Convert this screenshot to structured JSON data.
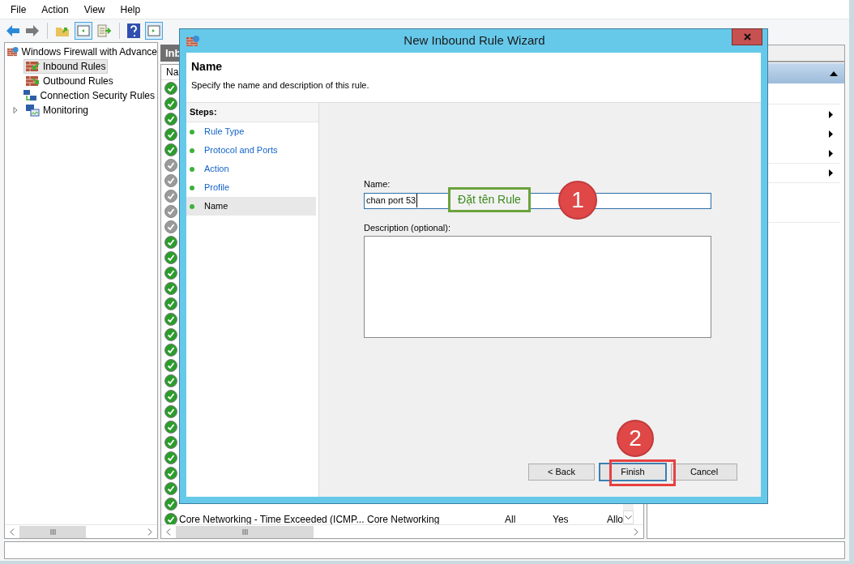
{
  "menu": [
    "File",
    "Action",
    "View",
    "Help"
  ],
  "tree": {
    "label": "Windows Firewall with Advance",
    "children": [
      {
        "label": "Inbound Rules",
        "selected": true,
        "kind": "inbound"
      },
      {
        "label": "Outbound Rules",
        "selected": false,
        "kind": "outbound"
      },
      {
        "label": "Connection Security Rules",
        "selected": false,
        "kind": "security"
      },
      {
        "label": "Monitoring",
        "selected": false,
        "kind": "monitor",
        "expanded": false
      }
    ]
  },
  "rules_pane": {
    "title": "Inb",
    "column_1": "Na",
    "rows": [
      {
        "enabled": true
      },
      {
        "enabled": true
      },
      {
        "enabled": true
      },
      {
        "enabled": true
      },
      {
        "enabled": true
      },
      {
        "enabled": false
      },
      {
        "enabled": false
      },
      {
        "enabled": false
      },
      {
        "enabled": false
      },
      {
        "enabled": false
      },
      {
        "enabled": true
      },
      {
        "enabled": true
      },
      {
        "enabled": true
      },
      {
        "enabled": true
      },
      {
        "enabled": true
      },
      {
        "enabled": true
      },
      {
        "enabled": true
      },
      {
        "enabled": true
      },
      {
        "enabled": true
      },
      {
        "enabled": true
      },
      {
        "enabled": true
      },
      {
        "enabled": true
      },
      {
        "enabled": true
      },
      {
        "enabled": true
      },
      {
        "enabled": true
      },
      {
        "enabled": true
      },
      {
        "enabled": true
      },
      {
        "enabled": true
      },
      {
        "enabled": true,
        "cells": [
          "Core Networking - Time Exceeded (ICMP...",
          "Core Networking",
          "All",
          "Yes",
          "Allo"
        ]
      }
    ]
  },
  "dialog": {
    "title": "New Inbound Rule Wizard",
    "heading": "Name",
    "subheading": "Specify the name and description of this rule.",
    "steps_label": "Steps:",
    "steps": [
      {
        "label": "Rule Type",
        "selected": false
      },
      {
        "label": "Protocol and Ports",
        "selected": false
      },
      {
        "label": "Action",
        "selected": false
      },
      {
        "label": "Profile",
        "selected": false
      },
      {
        "label": "Name",
        "selected": true
      }
    ],
    "name_label": "Name:",
    "name_value": "chan port 53",
    "description_label": "Description (optional):",
    "buttons": [
      {
        "label": "< Back",
        "kind": "normal"
      },
      {
        "label": "Finish",
        "kind": "default"
      },
      {
        "label": "Cancel",
        "kind": "normal"
      }
    ]
  },
  "name_callout": "Đặt tên Rule",
  "step_markers": [
    "1",
    "2"
  ]
}
